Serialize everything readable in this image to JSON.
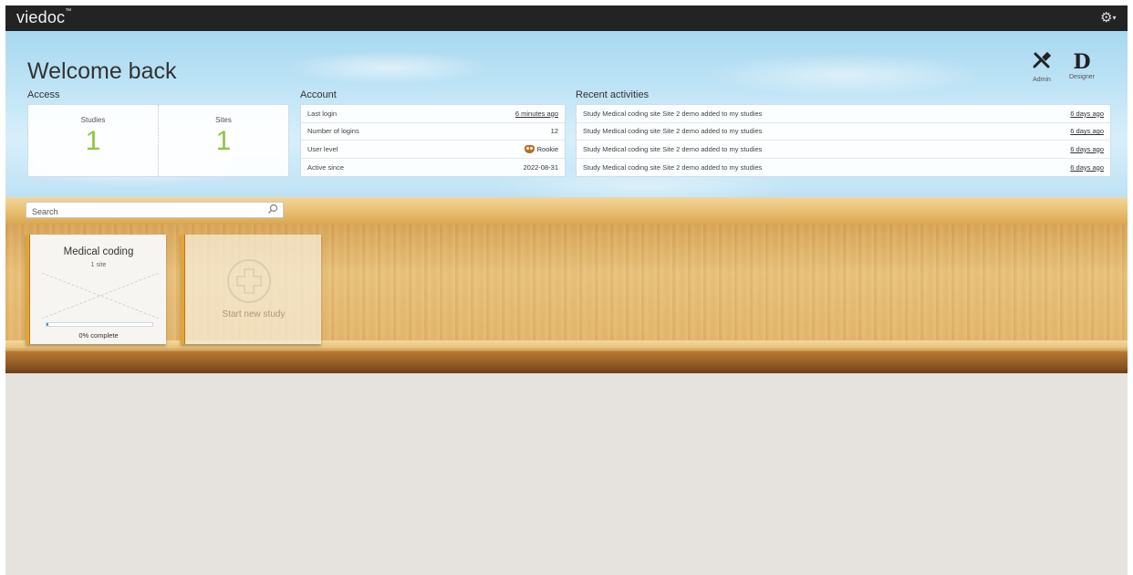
{
  "app": {
    "brand": "viedoc",
    "brand_mark": "™"
  },
  "header": {
    "welcome": "Welcome back",
    "tools": [
      {
        "label": "Admin",
        "icon": "admin-tools-icon"
      },
      {
        "label": "Designer",
        "icon": "designer-d-icon"
      }
    ]
  },
  "access": {
    "title": "Access",
    "studies_label": "Studies",
    "studies_value": "1",
    "sites_label": "Sites",
    "sites_value": "1"
  },
  "account": {
    "title": "Account",
    "rows": [
      {
        "label": "Last login",
        "value": "6 minutes ago"
      },
      {
        "label": "Number of logins",
        "value": "12"
      },
      {
        "label": "User level",
        "value": "Rookie"
      },
      {
        "label": "Active since",
        "value": "2022-08-31"
      }
    ]
  },
  "recent": {
    "title": "Recent activities",
    "rows": [
      {
        "text": "Study Medical coding site Site 2 demo added to my studies",
        "time": "6 days ago"
      },
      {
        "text": "Study Medical coding site Site 2 demo added to my studies",
        "time": "6 days ago"
      },
      {
        "text": "Study Medical coding site Site 2 demo added to my studies",
        "time": "6 days ago"
      },
      {
        "text": "Study Medical coding site Site 2 demo added to my studies",
        "time": "6 days ago"
      }
    ]
  },
  "search": {
    "placeholder": "Search"
  },
  "studies": [
    {
      "title": "Medical coding",
      "sites": "1 site",
      "progress": 0.0,
      "progress_label": "0% complete"
    }
  ],
  "new_study": {
    "label": "Start new study"
  },
  "colors": {
    "accent_green": "#8dc63f",
    "topbar": "#232323",
    "card_spine": "#e3a33b"
  }
}
